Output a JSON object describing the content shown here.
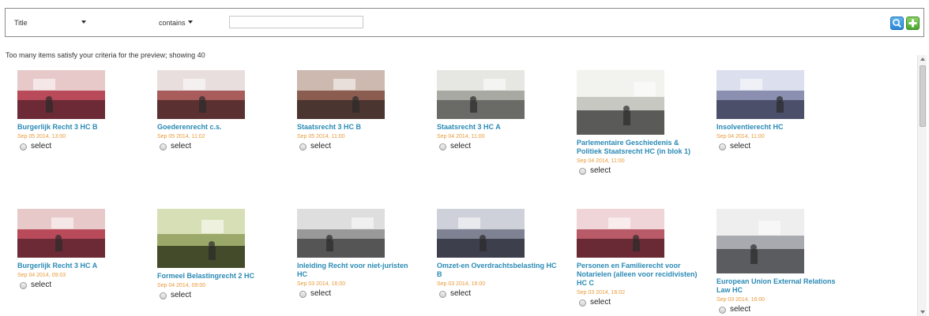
{
  "filter": {
    "field_value": "Title",
    "operator_value": "contains",
    "search_value": ""
  },
  "notice": "Too many items satisfy your criteria for the preview; showing 40",
  "select_label": "select",
  "colors": {
    "title_link": "#2a8ab5",
    "date": "#e89a3a",
    "search_button": "#2a86d6",
    "add_button": "#4aa52e"
  },
  "items": [
    {
      "title": "Burgerlijk Recht 3 HC B",
      "date": "Sep 05 2014, 13:00",
      "thumb": "lecture-hall-red"
    },
    {
      "title": "Goederenrecht c.s.",
      "date": "Sep 05 2014, 11:02",
      "thumb": "lecture-hall-wide"
    },
    {
      "title": "Staatsrecht 3 HC B",
      "date": "Sep 05 2014, 11:00",
      "thumb": "lecture-room-dark"
    },
    {
      "title": "Staatsrecht 3 HC A",
      "date": "Sep 04 2014, 11:00",
      "thumb": "lecture-room-desk"
    },
    {
      "title": "Parlementaire Geschiedenis & Politiek Staatsrecht HC (in blok 1)",
      "date": "Sep 04 2014, 11:00",
      "thumb": "lecture-speaker-screen"
    },
    {
      "title": "Insolventierecht HC",
      "date": "Sep 04 2014, 11:00",
      "thumb": "lecture-hall-students"
    },
    {
      "title": "Burgerlijk Recht 3 HC A",
      "date": "Sep 04 2014, 09:03",
      "thumb": "lecture-hall-red"
    },
    {
      "title": "Formeel Belastingrecht 2 HC",
      "date": "Sep 04 2014, 09:00",
      "thumb": "lecture-slide-green"
    },
    {
      "title": "Inleiding Recht voor niet-juristen HC",
      "date": "Sep 03 2014, 16:00",
      "thumb": "lecture-room-gray"
    },
    {
      "title": "Omzet-en Overdrachtsbelasting HC B",
      "date": "Sep 03 2014, 16:00",
      "thumb": "lecture-speaker-dark"
    },
    {
      "title": "Personen en Familierecht voor Notarielen (alleen voor recidivisten) HC C",
      "date": "Sep 03 2014, 16:02",
      "thumb": "lecture-speaker-red"
    },
    {
      "title": "European Union External Relations Law HC",
      "date": "Sep 03 2014, 16:00",
      "thumb": "lecture-whiteboard"
    }
  ]
}
